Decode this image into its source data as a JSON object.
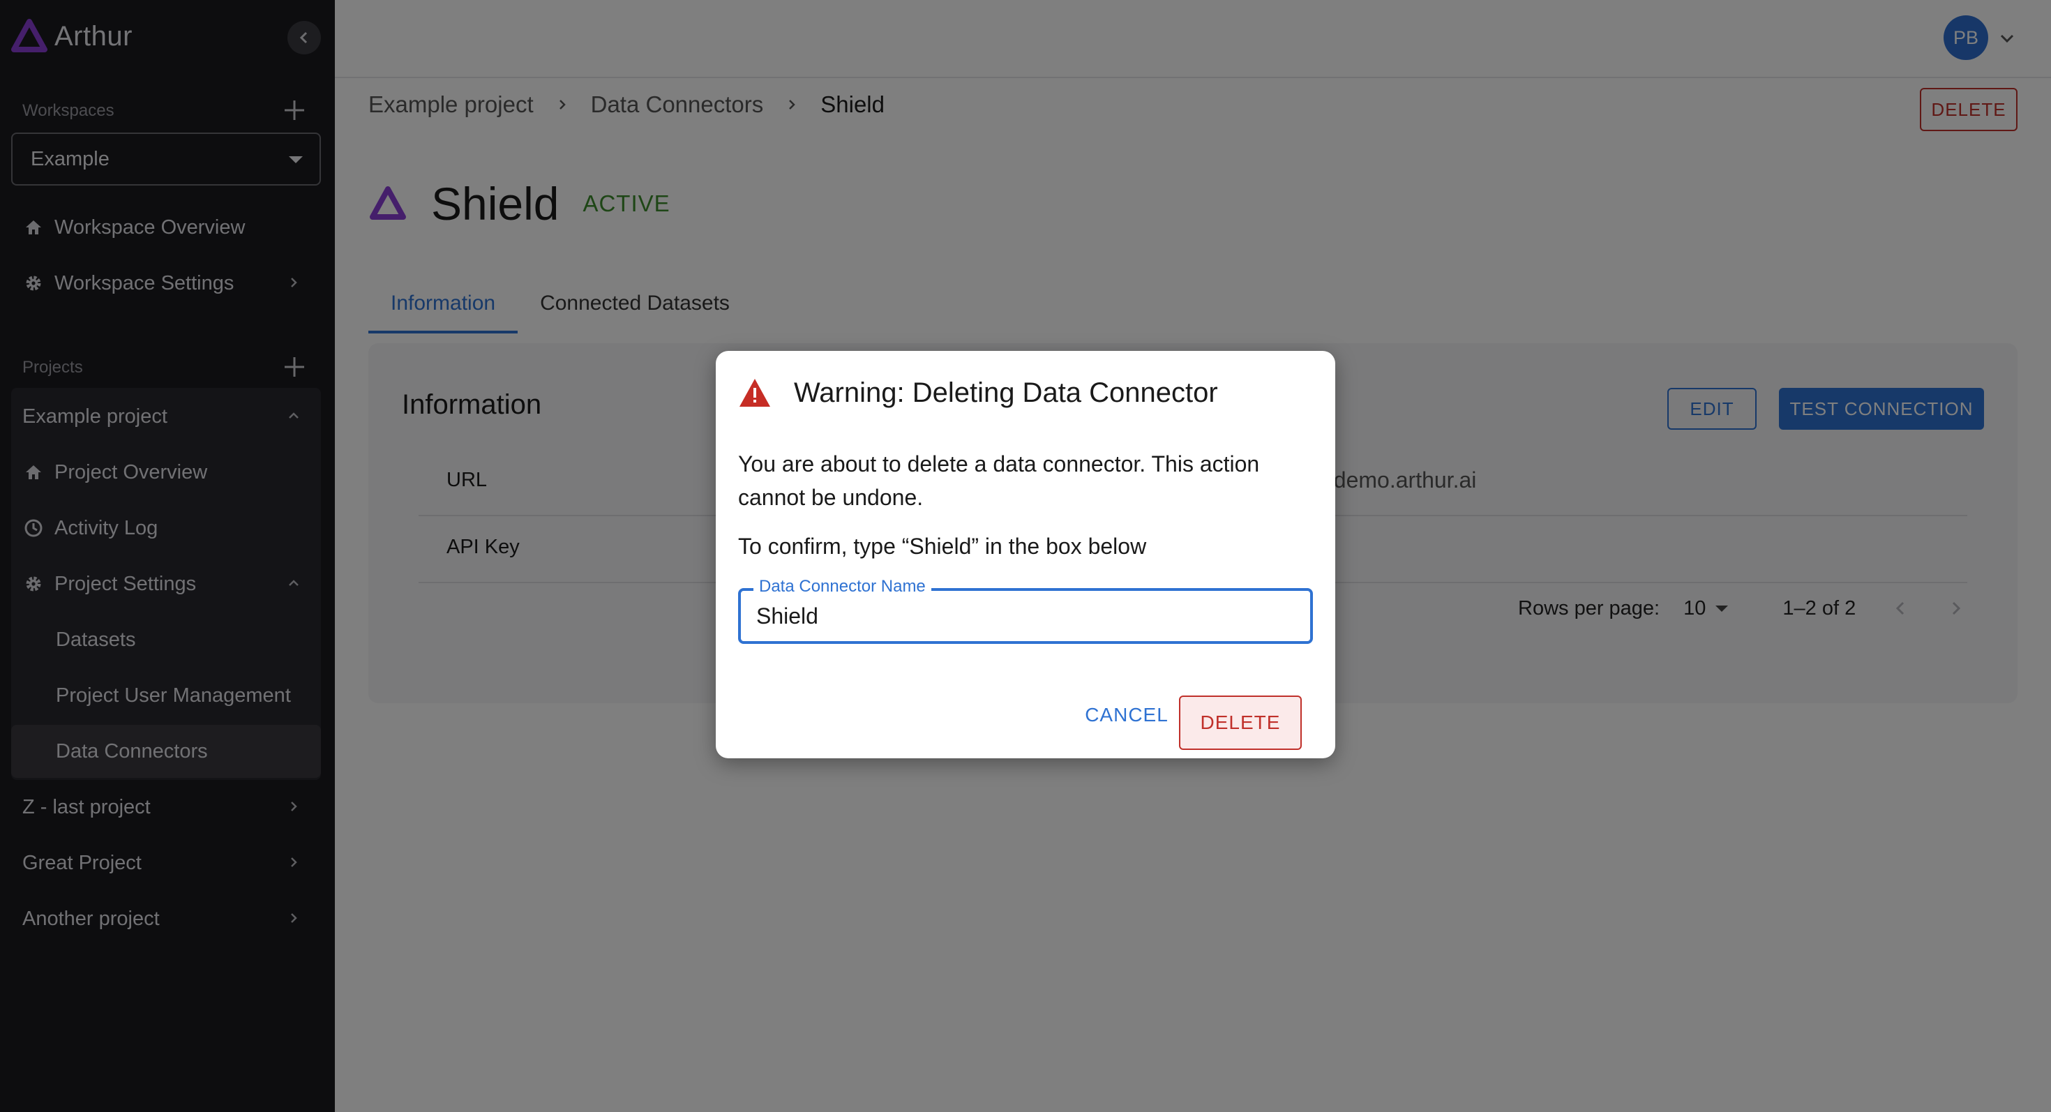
{
  "app": {
    "name": "Arthur"
  },
  "sidebar": {
    "workspaces_label": "Workspaces",
    "workspace_selected": "Example",
    "workspace_items": [
      {
        "label": "Workspace Overview",
        "icon": "home-icon"
      },
      {
        "label": "Workspace Settings",
        "icon": "gear-icon"
      }
    ],
    "projects_label": "Projects",
    "active_project": {
      "label": "Example project",
      "items": [
        {
          "label": "Project Overview",
          "icon": "home-icon"
        },
        {
          "label": "Activity Log",
          "icon": "clock-icon"
        },
        {
          "label": "Project Settings",
          "icon": "gear-icon"
        }
      ],
      "settings_items": [
        "Datasets",
        "Project User Management",
        "Data Connectors"
      ],
      "selected_item": "Data Connectors"
    },
    "other_projects": [
      "Z - last project",
      "Great Project",
      "Another project"
    ]
  },
  "header": {
    "avatar_initials": "PB"
  },
  "breadcrumb": [
    "Example project",
    "Data Connectors",
    "Shield"
  ],
  "page": {
    "delete_label": "DELETE",
    "title": "Shield",
    "status": "ACTIVE",
    "tabs": [
      "Information",
      "Connected Datasets"
    ],
    "active_tab": "Information"
  },
  "info_card": {
    "title": "Information",
    "edit_label": "EDIT",
    "test_label": "TEST CONNECTION",
    "rows": [
      {
        "key": "URL",
        "value": "ld.demo.arthur.ai"
      },
      {
        "key": "API Key",
        "value": ""
      }
    ],
    "rows_per_page_label": "Rows per page:",
    "rows_per_page": "10",
    "range": "1–2 of 2"
  },
  "dialog": {
    "title": "Warning: Deleting Data Connector",
    "body": "You are about to delete a data connector. This action cannot be undone.",
    "confirm_text": "To confirm, type “Shield” in the box below",
    "field_label": "Data Connector Name",
    "field_value": "Shield",
    "cancel_label": "CANCEL",
    "delete_label": "DELETE"
  },
  "colors": {
    "accent": "#2f72d2",
    "brand": "#7b2fbf",
    "danger": "#c0302a",
    "success": "#3d8c2c",
    "sidebar_bg": "#1b1a1f"
  }
}
